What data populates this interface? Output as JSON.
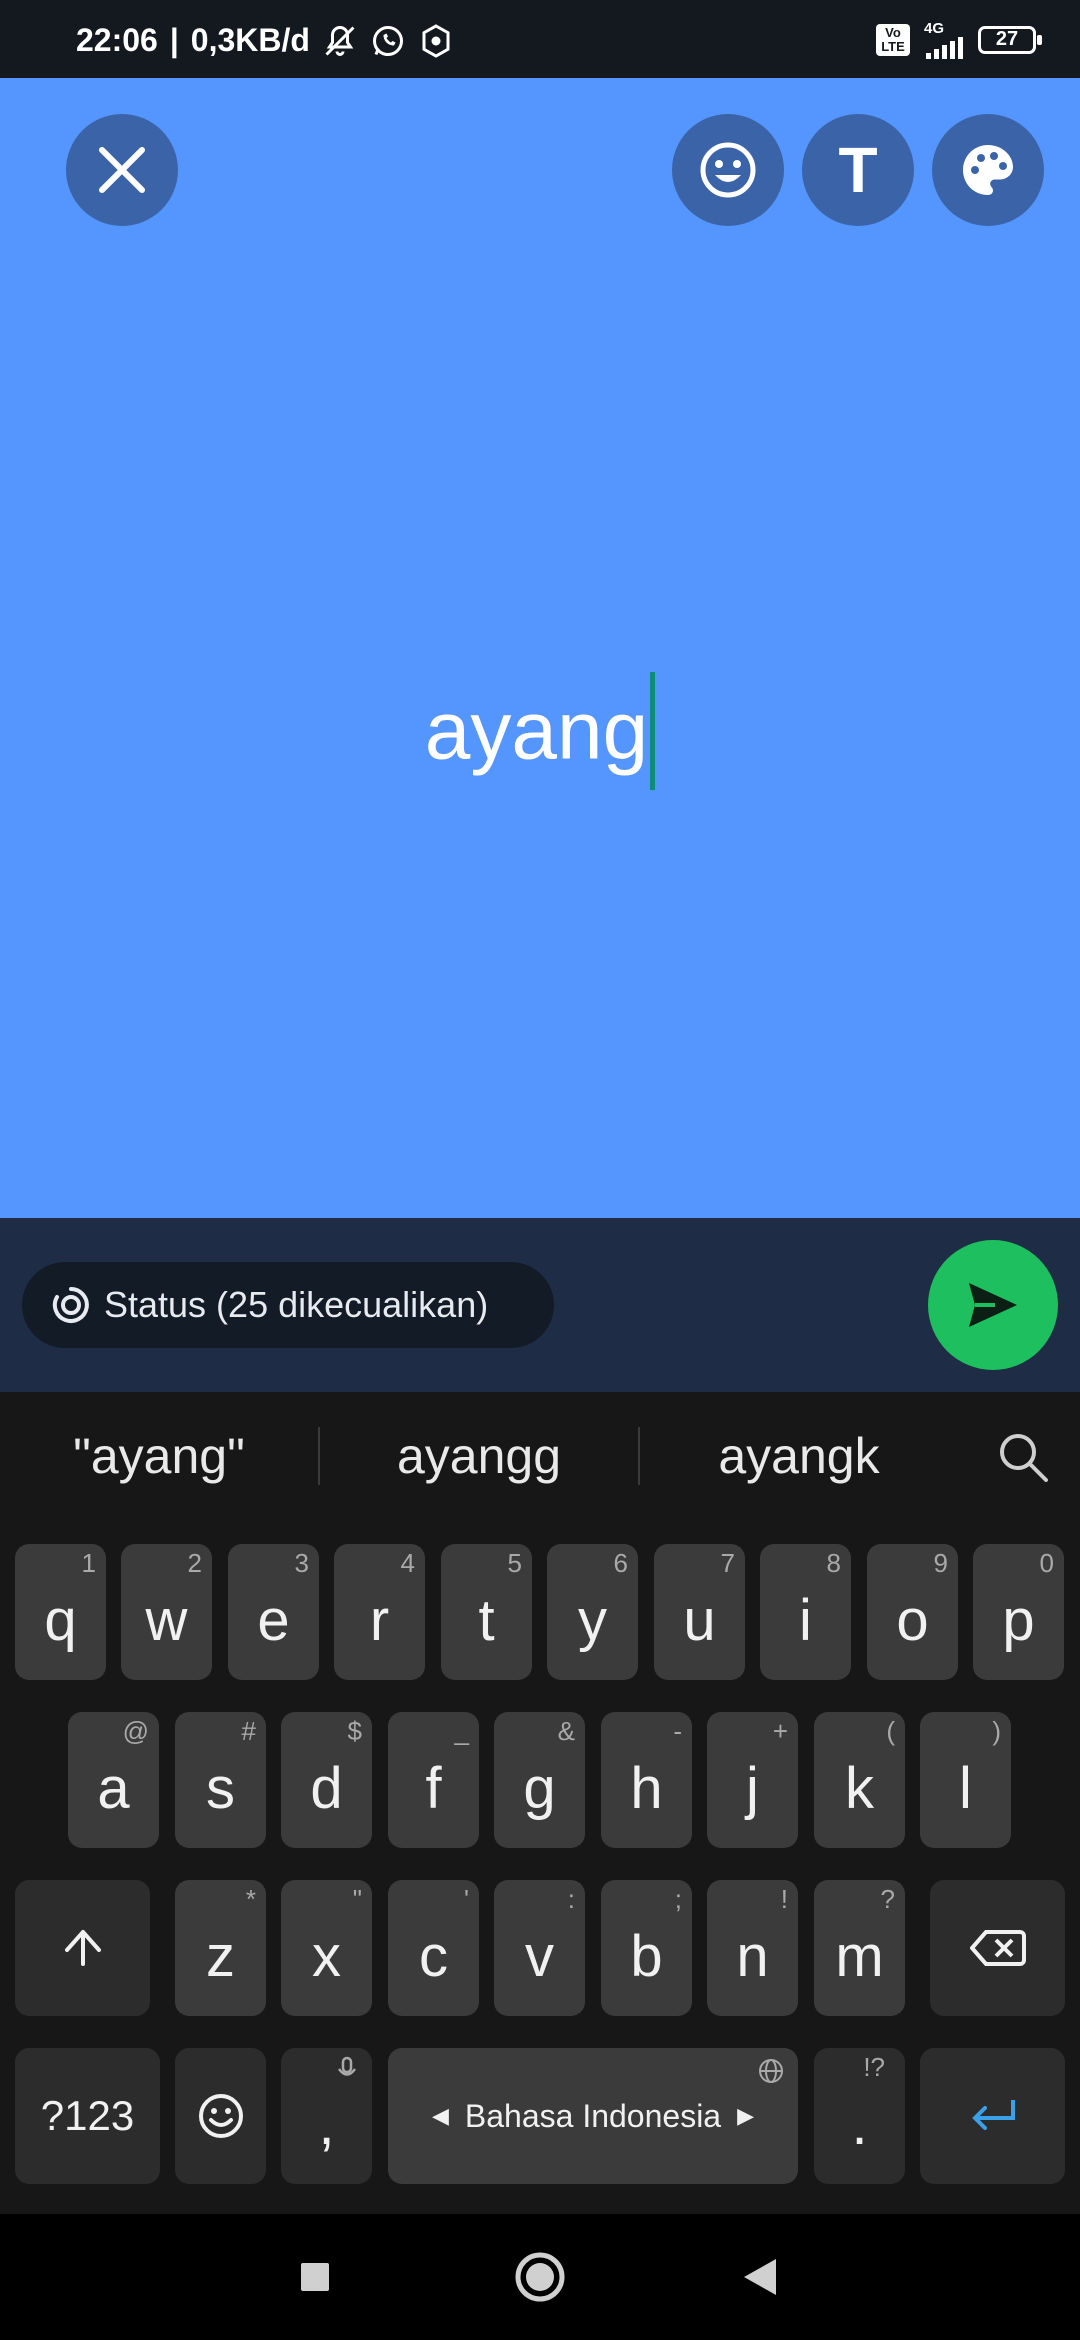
{
  "status_bar": {
    "time": "22:06",
    "speed": "0,3KB/d",
    "volte": "Vo LTE",
    "network": "4G",
    "battery": "27"
  },
  "editor": {
    "text": "ayang",
    "background_color": "#5595fe",
    "buttons": {
      "close": "close-icon",
      "emoji": "emoji-icon",
      "font": "T",
      "palette": "palette-icon"
    }
  },
  "audience_chip": {
    "label": "Status (25 dikecualikan)"
  },
  "send_button": {
    "icon": "send-icon",
    "color": "#1ebf5e"
  },
  "keyboard": {
    "suggestions": [
      "\"ayang\"",
      "ayangg",
      "ayangk"
    ],
    "row1": [
      {
        "key": "q",
        "hint": "1"
      },
      {
        "key": "w",
        "hint": "2"
      },
      {
        "key": "e",
        "hint": "3"
      },
      {
        "key": "r",
        "hint": "4"
      },
      {
        "key": "t",
        "hint": "5"
      },
      {
        "key": "y",
        "hint": "6"
      },
      {
        "key": "u",
        "hint": "7"
      },
      {
        "key": "i",
        "hint": "8"
      },
      {
        "key": "o",
        "hint": "9"
      },
      {
        "key": "p",
        "hint": "0"
      }
    ],
    "row2": [
      {
        "key": "a",
        "hint": "@"
      },
      {
        "key": "s",
        "hint": "#"
      },
      {
        "key": "d",
        "hint": "$"
      },
      {
        "key": "f",
        "hint": "_"
      },
      {
        "key": "g",
        "hint": "&"
      },
      {
        "key": "h",
        "hint": "-"
      },
      {
        "key": "j",
        "hint": "+"
      },
      {
        "key": "k",
        "hint": "("
      },
      {
        "key": "l",
        "hint": ")"
      }
    ],
    "row3": [
      {
        "key": "z",
        "hint": "*"
      },
      {
        "key": "x",
        "hint": "\""
      },
      {
        "key": "c",
        "hint": "'"
      },
      {
        "key": "v",
        "hint": ":"
      },
      {
        "key": "b",
        "hint": ";"
      },
      {
        "key": "n",
        "hint": "!"
      },
      {
        "key": "m",
        "hint": "?"
      }
    ],
    "symbols_key": "?123",
    "comma_key": ",",
    "space_label": "Bahasa Indonesia",
    "period_key": ".",
    "period_hint": "!?"
  }
}
